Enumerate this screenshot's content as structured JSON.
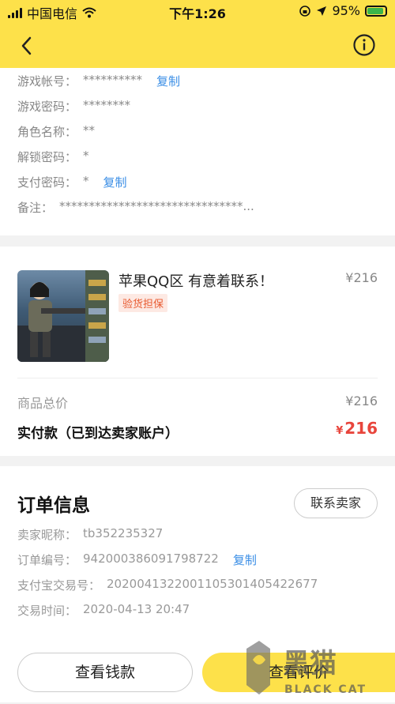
{
  "statusbar": {
    "carrier": "中国电信",
    "time": "下午1:26",
    "battery": "95%"
  },
  "account": {
    "rows": [
      {
        "label": "游戏帐号：",
        "value": "**********",
        "copy": "复制"
      },
      {
        "label": "游戏密码：",
        "value": "********"
      },
      {
        "label": "角色名称：",
        "value": "**"
      },
      {
        "label": "解锁密码：",
        "value": "*"
      },
      {
        "label": "支付密码：",
        "value": "*",
        "copy": "复制"
      },
      {
        "label": "备注：",
        "value": "*******************************..."
      }
    ]
  },
  "goods": {
    "title": "苹果QQ区 有意着联系！",
    "price": "¥216",
    "tag": "验货担保",
    "total_label": "商品总价",
    "total_value": "¥216",
    "paid_label": "实付款（已到达卖家账户）",
    "paid_currency": "¥",
    "paid_amount": "216"
  },
  "order": {
    "title": "订单信息",
    "contact_button": "联系卖家",
    "rows": [
      {
        "label": "卖家昵称：",
        "value": "tb352235327"
      },
      {
        "label": "订单编号：",
        "value": "942000386091798722",
        "copy": "复制"
      },
      {
        "label": "支付宝交易号：",
        "value": "2020041322001105301405422677"
      },
      {
        "label": "交易时间：",
        "value": "2020-04-13 20:47"
      }
    ],
    "view_money_button": "查看钱款",
    "view_review_button": "查看评价"
  },
  "watermark": {
    "cn": "黑猫",
    "en": "BLACK CAT"
  },
  "colors": {
    "accent": "#fde14a",
    "link": "#3a8ee6",
    "price_red": "#e8453c",
    "tag_orange": "#e8592f"
  }
}
